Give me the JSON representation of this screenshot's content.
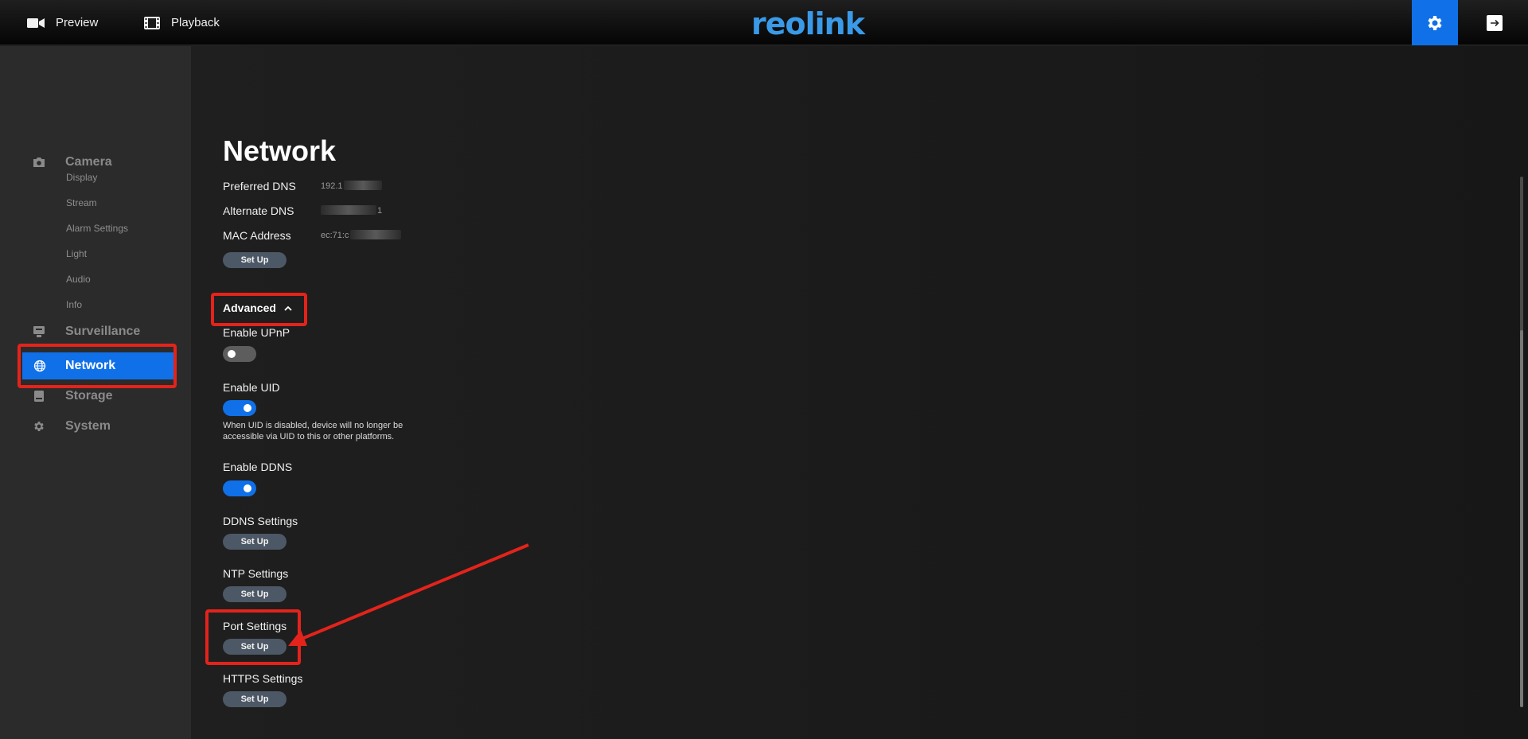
{
  "topbar": {
    "preview_label": "Preview",
    "playback_label": "Playback",
    "logo_text": "reolink"
  },
  "sidebar": {
    "items": [
      {
        "label": "Camera",
        "icon": "camera-icon"
      },
      {
        "label": "Surveillance",
        "icon": "monitor-icon"
      },
      {
        "label": "Network",
        "icon": "globe-icon",
        "active": true
      },
      {
        "label": "Storage",
        "icon": "storage-icon"
      },
      {
        "label": "System",
        "icon": "gear-icon"
      }
    ],
    "camera_subitems": [
      "Display",
      "Stream",
      "Alarm Settings",
      "Light",
      "Audio",
      "Info"
    ]
  },
  "main": {
    "title": "Network",
    "preferred_dns_label": "Preferred DNS",
    "preferred_dns_value": "192.1",
    "alternate_dns_label": "Alternate DNS",
    "alternate_dns_value": "1",
    "mac_label": "MAC Address",
    "mac_value": "ec:71:c",
    "setup_label": "Set Up",
    "advanced_label": "Advanced",
    "upnp_label": "Enable UPnP",
    "uid_label": "Enable UID",
    "uid_hint": "When UID is disabled, device will no longer be accessible via UID to this or other platforms.",
    "ddns_label": "Enable DDNS",
    "ddns_settings_label": "DDNS Settings",
    "ntp_settings_label": "NTP Settings",
    "port_settings_label": "Port Settings",
    "https_settings_label": "HTTPS Settings",
    "toggles": {
      "upnp": false,
      "uid": true,
      "ddns": true
    }
  },
  "colors": {
    "accent": "#1070e8",
    "annotation": "#e4231b",
    "logo": "#3a9ae8"
  }
}
